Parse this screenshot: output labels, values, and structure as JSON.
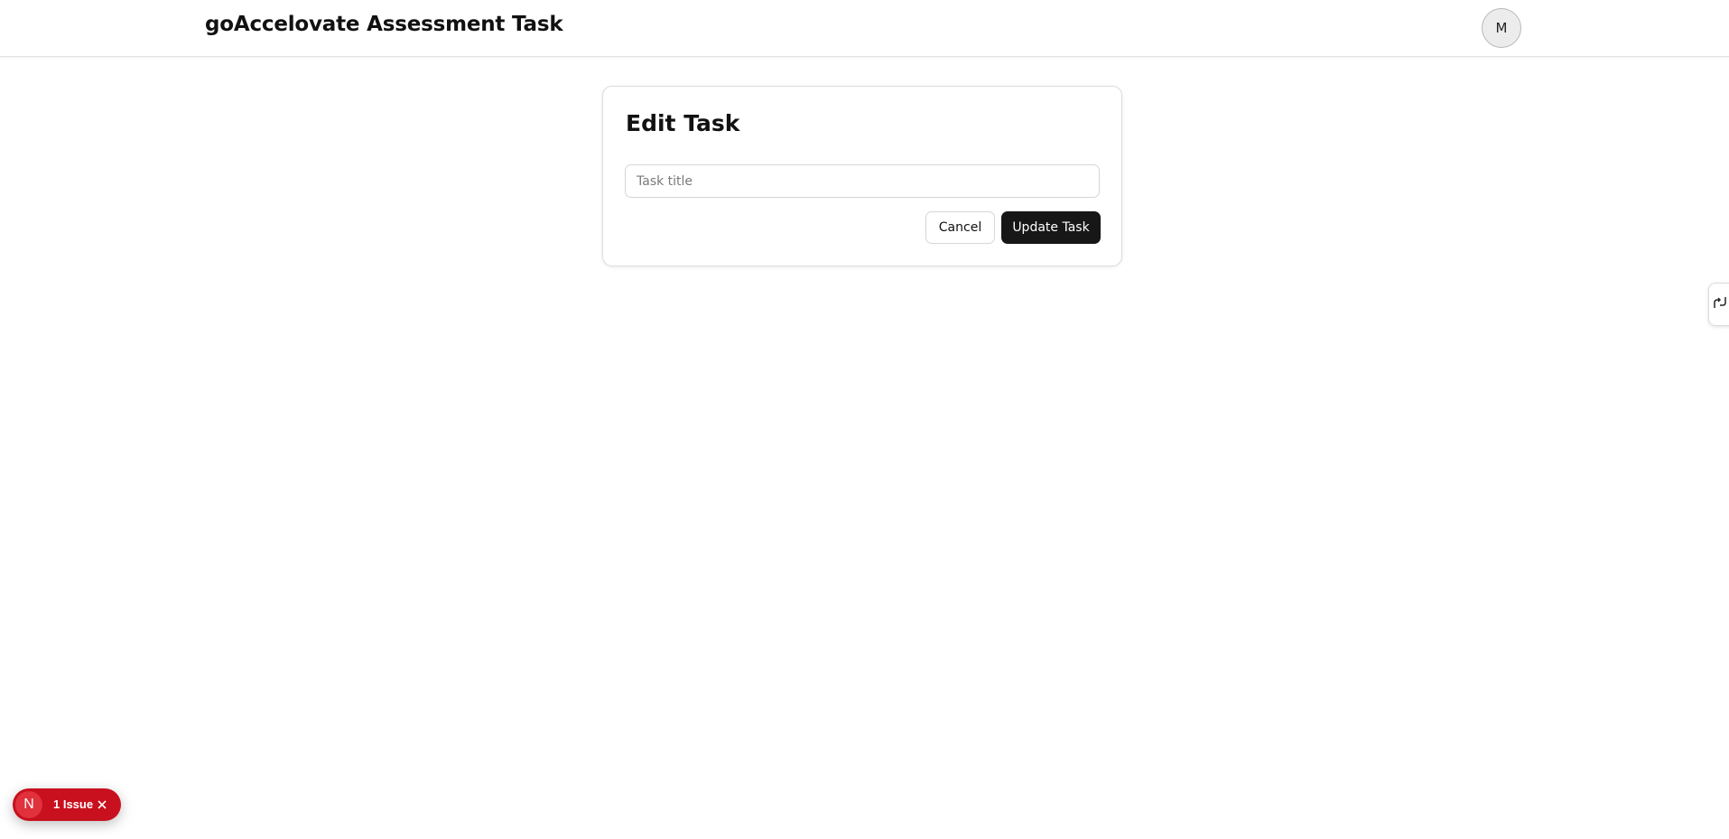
{
  "header": {
    "app_title": "goAccelovate Assessment Task",
    "avatar_initial": "M"
  },
  "edit_task": {
    "heading": "Edit Task",
    "title_input": {
      "value": "",
      "placeholder": "Task title"
    },
    "cancel_label": "Cancel",
    "update_label": "Update Task"
  },
  "side_tab": {
    "icon": "split-route-icon"
  },
  "dev_indicator": {
    "logo_letter": "N",
    "issue_label": "1 Issue",
    "close_icon": "close-icon",
    "color": "#c8101e"
  },
  "colors": {
    "primary_button": "#171717",
    "issue_badge": "#c8101e"
  }
}
